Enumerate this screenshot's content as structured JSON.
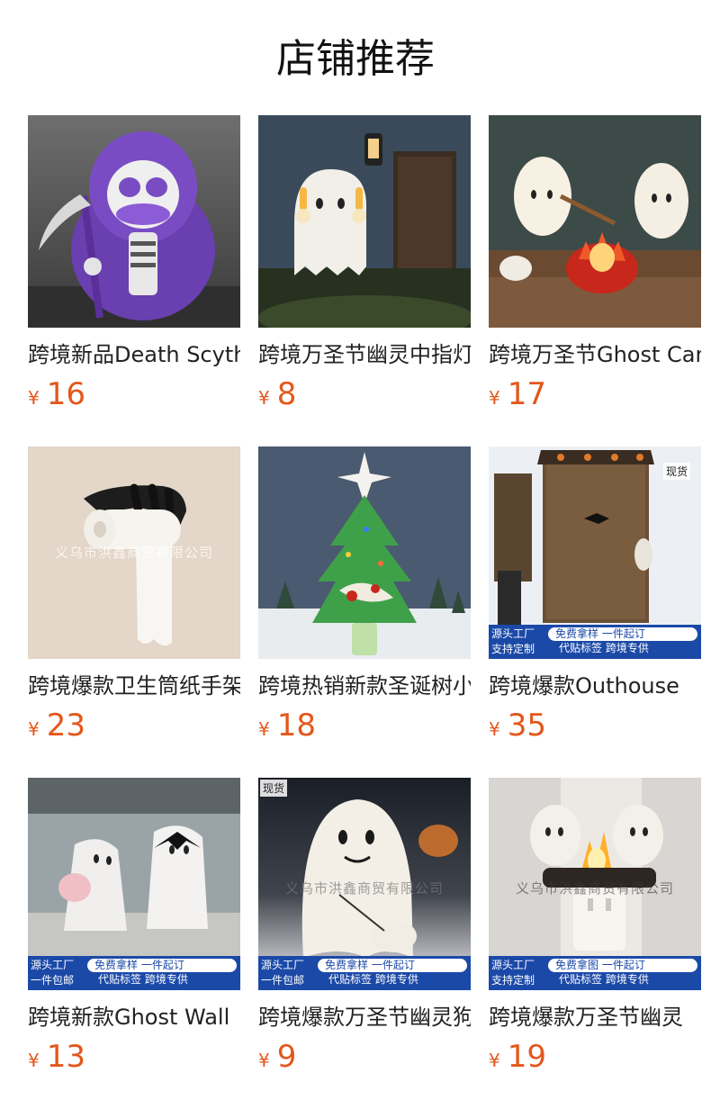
{
  "page": {
    "title": "店铺推荐"
  },
  "products": [
    {
      "name": "跨境新品Death Scythe",
      "currency": "¥",
      "price": "16"
    },
    {
      "name": "跨境万圣节幽灵中指灯",
      "currency": "¥",
      "price": "8"
    },
    {
      "name": "跨境万圣节Ghost Campfire",
      "currency": "¥",
      "price": "17"
    },
    {
      "name": "跨境爆款卫生筒纸手架",
      "currency": "¥",
      "price": "23",
      "watermark": "义乌市洪鑫商贸有限公司"
    },
    {
      "name": "跨境热销新款圣诞树小夜灯",
      "currency": "¥",
      "price": "18"
    },
    {
      "name": "跨境爆款Outhouse",
      "currency": "¥",
      "price": "35",
      "tag": "现货",
      "promo": {
        "left1": "源头工厂",
        "left2": "支持定制",
        "pill": "免费拿样  一件起订",
        "sub": "代贴标签  跨境专供"
      }
    },
    {
      "name": "跨境新款Ghost Wall",
      "currency": "¥",
      "price": "13",
      "promo": {
        "left1": "源头工厂",
        "left2": "一件包邮",
        "pill": "免费拿样  一件起订",
        "sub": "代贴标签  跨境专供"
      }
    },
    {
      "name": "跨境爆款万圣节幽灵狗",
      "currency": "¥",
      "price": "9",
      "tag": "现货",
      "watermark": "义乌市洪鑫商贸有限公司",
      "promo": {
        "left1": "源头工厂",
        "left2": "一件包邮",
        "pill": "免费拿样  一件起订",
        "sub": "代贴标签  跨境专供"
      }
    },
    {
      "name": "跨境爆款万圣节幽灵",
      "currency": "¥",
      "price": "19",
      "watermark": "义乌市洪鑫商贸有限公司",
      "promo": {
        "left1": "源头工厂",
        "left2": "支持定制",
        "pill": "免费拿图  一件起订",
        "sub": "代贴标签  跨境专供"
      }
    }
  ],
  "colors": {
    "price": "#e4571b",
    "promo_blue": "#1b49a8",
    "title": "#111111"
  }
}
